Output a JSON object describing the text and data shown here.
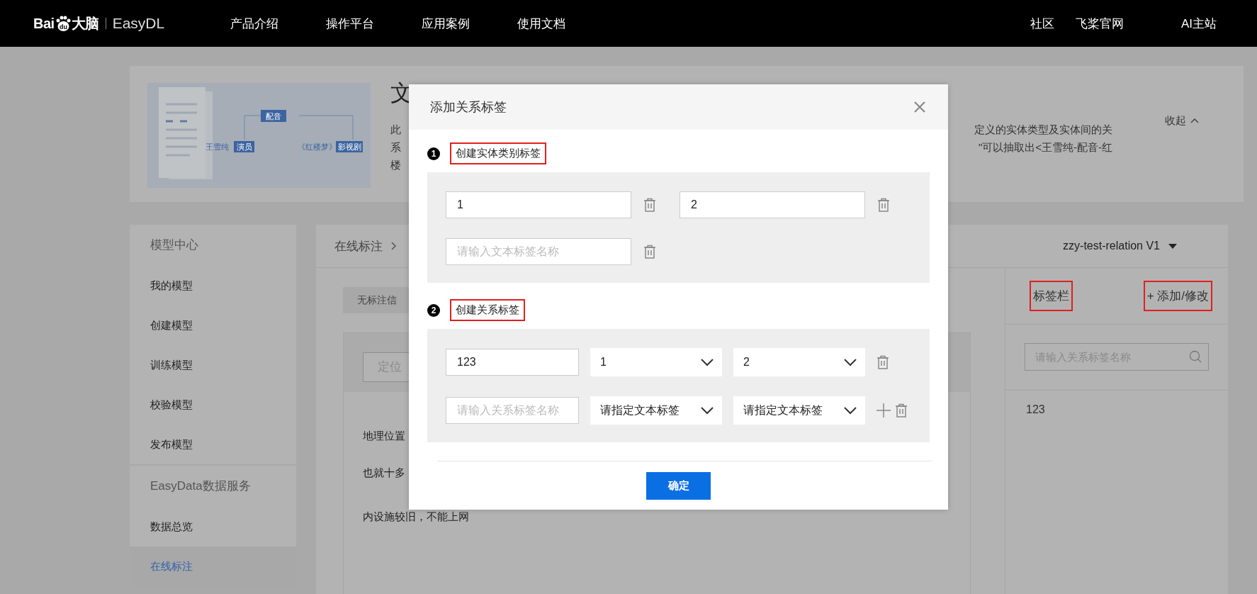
{
  "top_bar": {
    "logo": {
      "left": "Bai",
      "mark": "du",
      "right": "大脑",
      "product": "EasyDL"
    },
    "nav": [
      "产品介绍",
      "操作平台",
      "应用案例",
      "使用文档"
    ],
    "links": [
      "社区",
      "飞桨官网",
      "AI主站"
    ]
  },
  "banner": {
    "diagram": {
      "relation": "配音",
      "subject": "王雪纯",
      "subject_type": "演员",
      "object": "《红楼梦》",
      "object_type": "影视剧"
    },
    "title": "文",
    "left_lines": [
      "此",
      "系",
      "楼"
    ],
    "right_lines": [
      "定义的实体类型及实体间的关",
      "\"可以抽取出<王雪纯-配音-红"
    ],
    "collapse": "收起"
  },
  "sidebar": {
    "sections": [
      {
        "title": "模型中心",
        "items": [
          {
            "label": "我的模型",
            "selected": false
          },
          {
            "label": "创建模型",
            "selected": false
          },
          {
            "label": "训练模型",
            "selected": false
          },
          {
            "label": "校验模型",
            "selected": false
          },
          {
            "label": "发布模型",
            "selected": false
          }
        ]
      },
      {
        "title": "EasyData数据服务",
        "items": [
          {
            "label": "数据总览",
            "selected": false
          },
          {
            "label": "在线标注",
            "selected": true
          }
        ]
      }
    ]
  },
  "workspace": {
    "breadcrumb": "在线标注",
    "model": "zzy-test-relation V1",
    "filter_tab": "无标注信",
    "search": {
      "placeholder": "定位"
    },
    "lines": [
      "地理位置",
      "也就十多",
      "内设施较旧，不能上网"
    ],
    "label_panel": {
      "title": {
        "text": "标签栏",
        "highlighted": true
      },
      "add_button": {
        "text": "+ 添加/修改",
        "highlighted": true
      },
      "search": {
        "placeholder": "请输入关系标签名称"
      },
      "labels": [
        "123"
      ]
    }
  },
  "modal": {
    "title": "添加关系标签",
    "sections": [
      {
        "kind": "entity",
        "number": "1",
        "label": "创建实体类别标签",
        "highlighted": true,
        "rows": [
          [
            {
              "value": "1"
            },
            {
              "value": "2"
            }
          ],
          [
            {
              "placeholder": "请输入文本标签名称"
            }
          ]
        ]
      },
      {
        "kind": "relation",
        "number": "2",
        "label": "创建关系标签",
        "highlighted": true,
        "rows": [
          {
            "name": {
              "value": "123"
            },
            "from": "1",
            "to": "2",
            "can_add": false
          },
          {
            "name": {
              "placeholder": "请输入关系标签名称"
            },
            "from": "请指定文本标签",
            "to": "请指定文本标签",
            "can_add": true
          }
        ]
      }
    ],
    "confirm": "确定"
  }
}
